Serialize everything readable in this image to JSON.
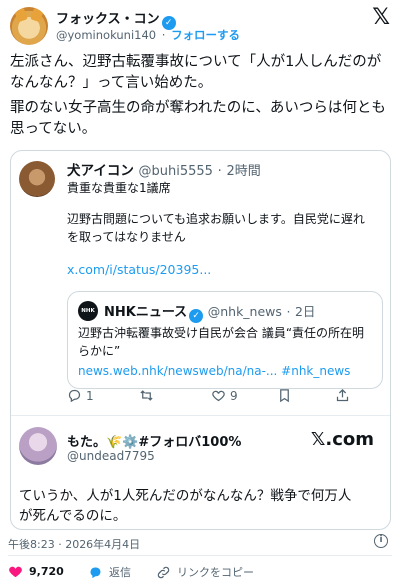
{
  "header": {
    "author_name": "フォックス・コン",
    "handle": "@yominokuni140",
    "separator": "·",
    "follow_label": "フォローする",
    "logo": "𝕏"
  },
  "post": {
    "paragraph1": "左派さん、辺野古転覆事故について「人が1人しんだのがなんなん？」って言い始めた。",
    "paragraph2": "罪のない女子高生の命が奪われたのに、あいつらは何とも思ってない。"
  },
  "quoted": {
    "author_name": "犬アイコン",
    "handle": "@buhi5555",
    "time": "2時間",
    "line1": "貴重な貴重な1議席",
    "line2": "辺野古問題についても追求お願いします。自民党に遅れ",
    "line3": "を取ってはなりません",
    "link": "x.com/i/status/20395...",
    "inner": {
      "logo_text": "NHK NEWS",
      "author_name": "NHKニュース",
      "handle": "@nhk_news",
      "time": "2日",
      "line1": "辺野古沖転覆事故受け自民が会合 議員“責任の所在明",
      "line2": "らかに”",
      "link_line": "news.web.nhk/newsweb/na/na-... #nhk_news"
    },
    "actions": {
      "reply_count": "1",
      "retweet_count": "",
      "like_count": "9"
    }
  },
  "reply": {
    "author_name": "もた。🌾⚙️#フォロバ100%",
    "handle": "@undead7795",
    "xcom_label": "𝕏.com",
    "text_line1": "ていうか、人が1人死んだのがなんなん？戦争で何万人",
    "text_line2": "が死んでるのに。"
  },
  "footer": {
    "timestamp": "午後8:23 · 2026年4月4日",
    "like_count": "9,720",
    "reply_label": "返信",
    "copy_link_label": "リンクをコピー"
  },
  "colors": {
    "accent": "#1d9bf0",
    "like": "#f91880",
    "muted": "#536471"
  }
}
